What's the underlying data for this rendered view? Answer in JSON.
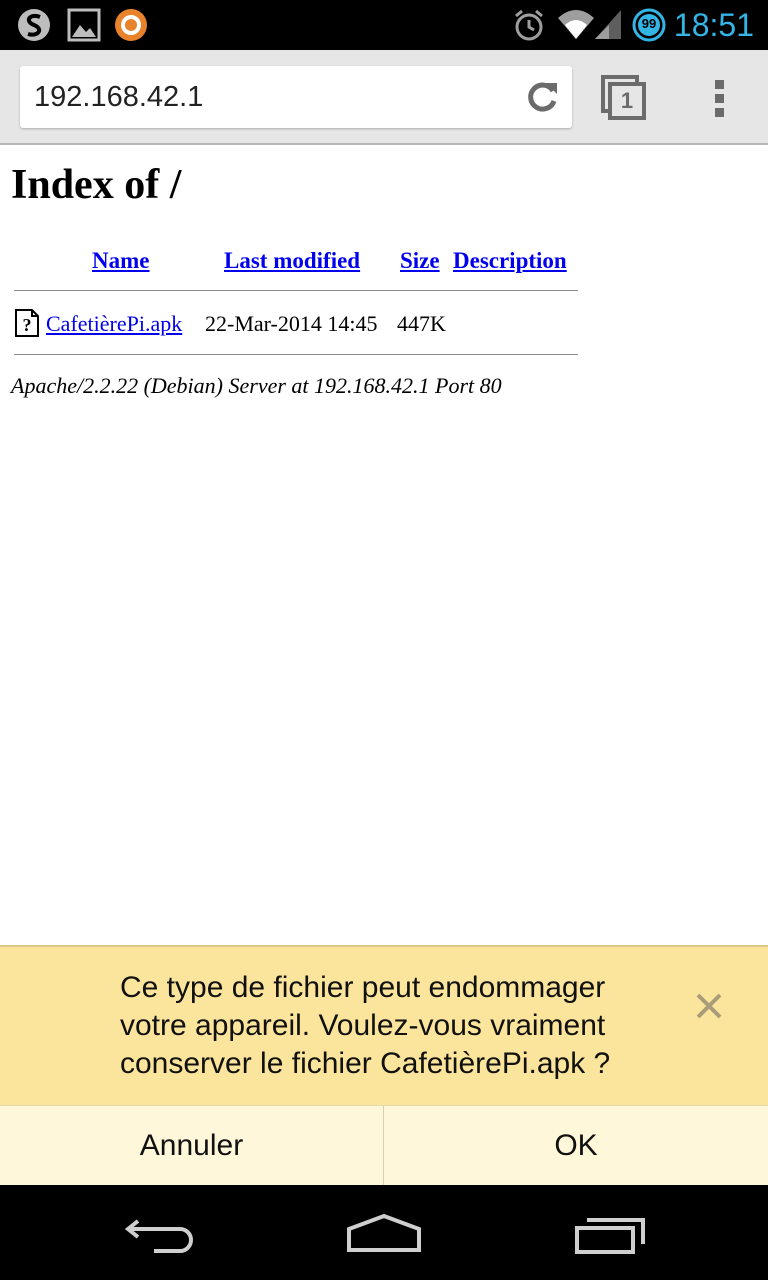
{
  "status_bar": {
    "time": "18:51",
    "battery_level": "99",
    "icons": [
      "app-s-icon",
      "gallery-icon",
      "avast-icon",
      "alarm-icon",
      "wifi-icon",
      "signal-icon",
      "battery-icon"
    ],
    "time_color": "#33b5e5"
  },
  "browser": {
    "url": "192.168.42.1",
    "tab_count": "1",
    "icons": [
      "reload-icon",
      "tabs-icon",
      "menu-icon"
    ]
  },
  "page": {
    "title": "Index of /",
    "columns": [
      "Name",
      "Last modified",
      "Size",
      "Description"
    ],
    "rows": [
      {
        "icon": "unknown-file-icon",
        "name": "CafetièrePi.apk",
        "last_modified": "22-Mar-2014 14:45",
        "size": "447K",
        "description": ""
      }
    ],
    "server_signature": "Apache/2.2.22 (Debian) Server at 192.168.42.1 Port 80",
    "link_color": "#0000ee"
  },
  "download_warning": {
    "line1": "Ce type de fichier peut endommager",
    "line2": "votre appareil. Voulez-vous vraiment",
    "line3": "conserver le fichier CafetièrePi.apk ?",
    "cancel_label": "Annuler",
    "ok_label": "OK",
    "background": "#fbe49b"
  },
  "nav_bar": {
    "icons": [
      "back-icon",
      "home-icon",
      "recents-icon"
    ]
  }
}
